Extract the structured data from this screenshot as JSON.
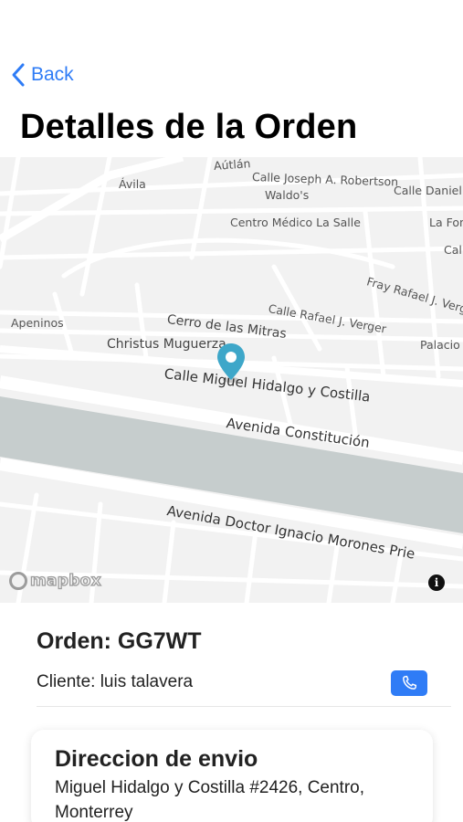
{
  "nav": {
    "back_label": "Back"
  },
  "page_title": "Detalles de la Orden",
  "map": {
    "labels": [
      "Aútlán",
      "Calle Joseph A. Robertson",
      "Ávila",
      "Waldo's",
      "Calle Daniel Z",
      "Centro Médico La Salle",
      "La Fon",
      "Call",
      "Fray Rafael J. Verger",
      "Calle Rafael J. Verger",
      "Cerro de las Mitras",
      "Apeninos",
      "Christus Muguerza",
      "Palacio",
      "Calle Miguel Hidalgo y Costilla",
      "Avenida Constitución",
      "Avenida Doctor Ignacio Morones Prie"
    ],
    "attribution": "mapbox",
    "info_glyph": "i",
    "pin_icon": "map-pin-icon",
    "colors": {
      "land": "#f2f2f2",
      "road": "#ffffff",
      "river": "#c6cdcd",
      "pin": "#3ea7c9"
    }
  },
  "order": {
    "id_label": "Orden: GG7WT",
    "client_label": "Cliente: luis talavera",
    "call_icon": "phone-icon"
  },
  "shipping": {
    "title": "Direccion de envio",
    "address": "Miguel Hidalgo y Costilla #2426, Centro, Monterrey"
  },
  "accent_color": "#2f7cf6"
}
